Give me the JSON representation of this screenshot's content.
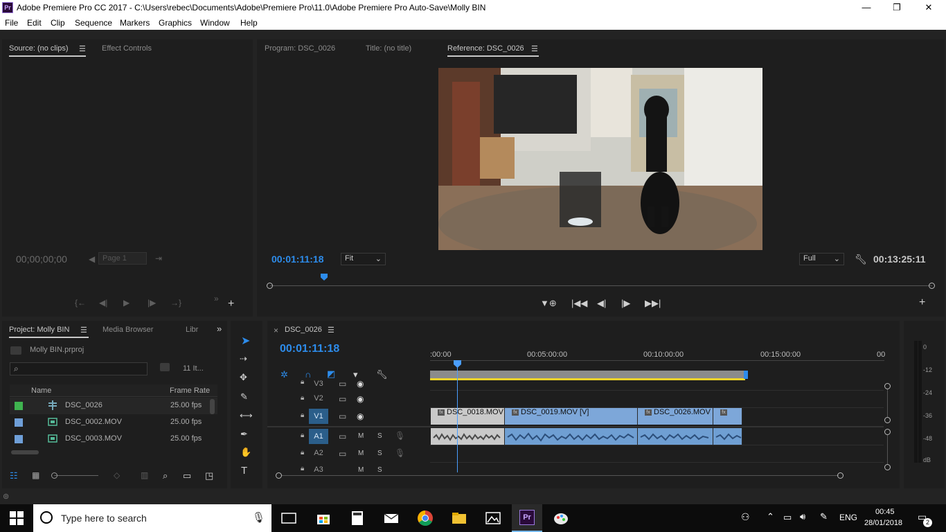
{
  "window": {
    "title": "Adobe Premiere Pro CC 2017 - C:\\Users\\rebec\\Documents\\Adobe\\Premiere Pro\\11.0\\Adobe Premiere Pro Auto-Save\\Molly BIN",
    "logo": "Pr",
    "minimize": "—",
    "maximize": "❐",
    "close": "✕"
  },
  "menu": [
    "File",
    "Edit",
    "Clip",
    "Sequence",
    "Markers",
    "Graphics",
    "Window",
    "Help"
  ],
  "source_panel": {
    "tab_source": "Source: (no clips)",
    "tab_effects": "Effect Controls",
    "timecode": "00;00;00;00",
    "page": "Page 1"
  },
  "program_panel": {
    "tab_program": "Program: DSC_0026",
    "tab_title": "Title: (no title)",
    "tab_reference": "Reference: DSC_0026",
    "timecode": "00:01:11:18",
    "zoom": "Fit",
    "quality": "Full",
    "duration": "00:13:25:11"
  },
  "project_panel": {
    "tab_project": "Project: Molly BIN",
    "tab_media": "Media Browser",
    "tab_lib": "Libr",
    "file": "Molly BIN.prproj",
    "item_count": "11 It...",
    "col_name": "Name",
    "col_rate": "Frame Rate",
    "rows": [
      {
        "name": "DSC_0026",
        "rate": "25.00 fps",
        "color": "#3fb34f"
      },
      {
        "name": "DSC_0002.MOV",
        "rate": "25.00 fps",
        "color": "#6f9fd8"
      },
      {
        "name": "DSC_0003.MOV",
        "rate": "25.00 fps",
        "color": "#6f9fd8"
      }
    ]
  },
  "timeline": {
    "tab": "DSC_0026",
    "timecode": "00:01:11:18",
    "ruler": [
      ":00:00",
      "00:05:00:00",
      "00:10:00:00",
      "00:15:00:00",
      "00"
    ],
    "tracks_video": [
      "V3",
      "V2",
      "V1"
    ],
    "tracks_audio": [
      "A1",
      "A2",
      "A3"
    ],
    "mute": "M",
    "solo": "S",
    "clips": [
      {
        "label": "DSC_0018.MOV",
        "color": "#c9c9c9"
      },
      {
        "label": "DSC_0019.MOV [V]",
        "color": "#7da7d9"
      },
      {
        "label": "DSC_0026.MOV",
        "color": "#7da7d9"
      },
      {
        "label": "",
        "color": "#7da7d9"
      }
    ],
    "fx": "fx"
  },
  "meter": {
    "labels": [
      "0",
      "-12",
      "-24",
      "-36",
      "-48",
      "dB"
    ]
  },
  "taskbar": {
    "search_placeholder": "Type here to search",
    "lang": "ENG",
    "time": "00:45",
    "date": "28/01/2018",
    "notifications": "2"
  },
  "colors": {
    "accent_blue": "#2d8ceb",
    "playhead": "#4a9eff",
    "work_area": "#f1d42a"
  }
}
